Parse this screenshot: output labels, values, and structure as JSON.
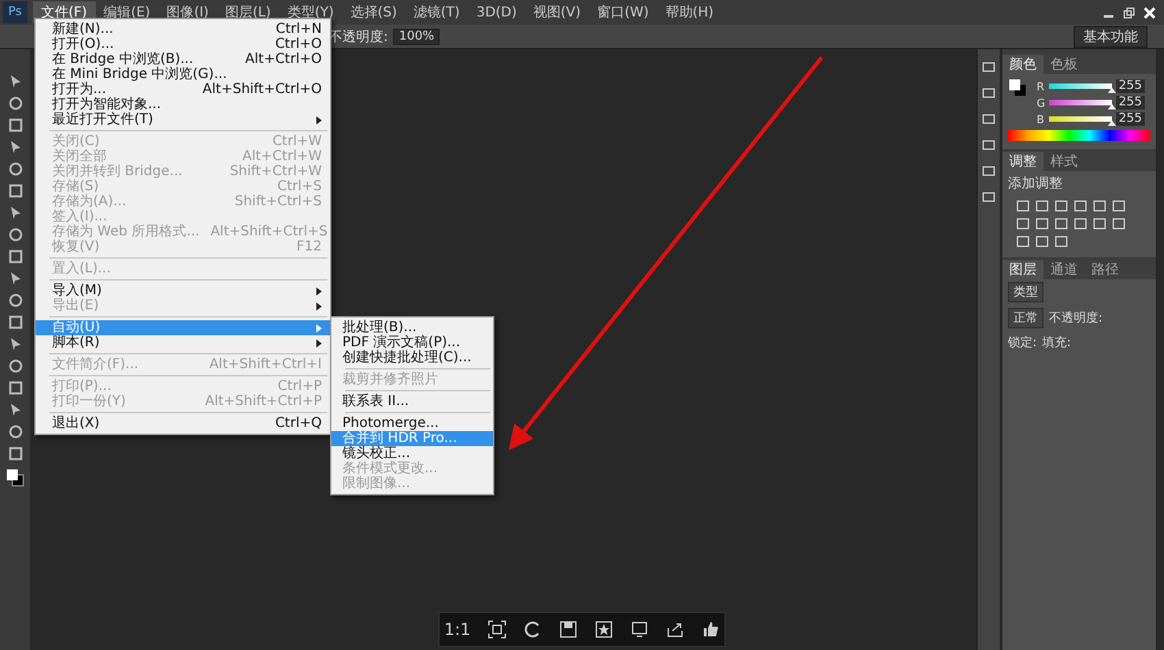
{
  "menu_bar": {
    "logo": "Ps",
    "items": [
      {
        "label": "文件(F)",
        "selected": true
      },
      {
        "label": "编辑(E)",
        "selected": false
      },
      {
        "label": "图像(I)",
        "selected": false
      },
      {
        "label": "图层(L)",
        "selected": false
      },
      {
        "label": "类型(Y)",
        "selected": false
      },
      {
        "label": "选择(S)",
        "selected": false
      },
      {
        "label": "滤镜(T)",
        "selected": false
      },
      {
        "label": "3D(D)",
        "selected": false
      },
      {
        "label": "视图(V)",
        "selected": false
      },
      {
        "label": "窗口(W)",
        "selected": false
      },
      {
        "label": "帮助(H)",
        "selected": false
      }
    ]
  },
  "options_bar": {
    "opacity_label": "不透明度:",
    "opacity_value": "100%",
    "workspace": "基本功能"
  },
  "file_menu": {
    "items": [
      {
        "kind": "item",
        "label": "新建(N)...",
        "shortcut": "Ctrl+N",
        "disabled": false,
        "selected": false,
        "submenu": false
      },
      {
        "kind": "item",
        "label": "打开(O)...",
        "shortcut": "Ctrl+O",
        "disabled": false,
        "selected": false,
        "submenu": false
      },
      {
        "kind": "item",
        "label": "在 Bridge 中浏览(B)...",
        "shortcut": "Alt+Ctrl+O",
        "disabled": false,
        "selected": false,
        "submenu": false
      },
      {
        "kind": "item",
        "label": "在 Mini Bridge 中浏览(G)...",
        "disabled": false,
        "selected": false,
        "submenu": false
      },
      {
        "kind": "item",
        "label": "打开为...",
        "shortcut": "Alt+Shift+Ctrl+O",
        "disabled": false,
        "selected": false,
        "submenu": false
      },
      {
        "kind": "item",
        "label": "打开为智能对象...",
        "disabled": false,
        "selected": false,
        "submenu": false
      },
      {
        "kind": "item",
        "label": "最近打开文件(T)",
        "disabled": false,
        "selected": false,
        "submenu": true
      },
      {
        "kind": "separator"
      },
      {
        "kind": "item",
        "label": "关闭(C)",
        "shortcut": "Ctrl+W",
        "disabled": true,
        "selected": false,
        "submenu": false
      },
      {
        "kind": "item",
        "label": "关闭全部",
        "shortcut": "Alt+Ctrl+W",
        "disabled": true,
        "selected": false,
        "submenu": false
      },
      {
        "kind": "item",
        "label": "关闭并转到 Bridge...",
        "shortcut": "Shift+Ctrl+W",
        "disabled": true,
        "selected": false,
        "submenu": false
      },
      {
        "kind": "item",
        "label": "存储(S)",
        "shortcut": "Ctrl+S",
        "disabled": true,
        "selected": false,
        "submenu": false
      },
      {
        "kind": "item",
        "label": "存储为(A)...",
        "shortcut": "Shift+Ctrl+S",
        "disabled": true,
        "selected": false,
        "submenu": false
      },
      {
        "kind": "item",
        "label": "签入(I)...",
        "disabled": true,
        "selected": false,
        "submenu": false
      },
      {
        "kind": "item",
        "label": "存储为 Web 所用格式...",
        "shortcut": "Alt+Shift+Ctrl+S",
        "disabled": true,
        "selected": false,
        "submenu": false
      },
      {
        "kind": "item",
        "label": "恢复(V)",
        "shortcut": "F12",
        "disabled": true,
        "selected": false,
        "submenu": false
      },
      {
        "kind": "separator"
      },
      {
        "kind": "item",
        "label": "置入(L)...",
        "disabled": true,
        "selected": false,
        "submenu": false
      },
      {
        "kind": "separator"
      },
      {
        "kind": "item",
        "label": "导入(M)",
        "disabled": false,
        "selected": false,
        "submenu": true
      },
      {
        "kind": "item",
        "label": "导出(E)",
        "disabled": true,
        "selected": false,
        "submenu": true
      },
      {
        "kind": "separator"
      },
      {
        "kind": "item",
        "label": "自动(U)",
        "disabled": false,
        "selected": true,
        "submenu": true,
        "children": [
          {
            "kind": "item",
            "label": "批处理(B)...",
            "disabled": false,
            "selected": false
          },
          {
            "kind": "item",
            "label": "PDF 演示文稿(P)...",
            "disabled": false,
            "selected": false
          },
          {
            "kind": "item",
            "label": "创建快捷批处理(C)...",
            "disabled": false,
            "selected": false
          },
          {
            "kind": "separator"
          },
          {
            "kind": "item",
            "label": "裁剪并修齐照片",
            "disabled": true,
            "selected": false
          },
          {
            "kind": "separator"
          },
          {
            "kind": "item",
            "label": "联系表 II...",
            "disabled": false,
            "selected": false
          },
          {
            "kind": "separator"
          },
          {
            "kind": "item",
            "label": "Photomerge...",
            "disabled": false,
            "selected": false
          },
          {
            "kind": "item",
            "label": "合并到 HDR Pro...",
            "disabled": false,
            "selected": true
          },
          {
            "kind": "item",
            "label": "镜头校正...",
            "disabled": false,
            "selected": false
          },
          {
            "kind": "item",
            "label": "条件模式更改...",
            "disabled": true,
            "selected": false
          },
          {
            "kind": "item",
            "label": "限制图像...",
            "disabled": true,
            "selected": false
          }
        ]
      },
      {
        "kind": "item",
        "label": "脚本(R)",
        "disabled": false,
        "selected": false,
        "submenu": true
      },
      {
        "kind": "separator"
      },
      {
        "kind": "item",
        "label": "文件简介(F)...",
        "shortcut": "Alt+Shift+Ctrl+I",
        "disabled": true,
        "selected": false,
        "submenu": false
      },
      {
        "kind": "separator"
      },
      {
        "kind": "item",
        "label": "打印(P)...",
        "shortcut": "Ctrl+P",
        "disabled": true,
        "selected": false,
        "submenu": false
      },
      {
        "kind": "item",
        "label": "打印一份(Y)",
        "shortcut": "Alt+Shift+Ctrl+P",
        "disabled": true,
        "selected": false,
        "submenu": false
      },
      {
        "kind": "separator"
      },
      {
        "kind": "item",
        "label": "退出(X)",
        "shortcut": "Ctrl+Q",
        "disabled": false,
        "selected": false,
        "submenu": false
      }
    ]
  },
  "color_panel": {
    "tabs": [
      {
        "label": "颜色",
        "selected": true
      },
      {
        "label": "色板",
        "selected": false
      }
    ],
    "channels": [
      {
        "name": "R",
        "level": 1,
        "reading": "255"
      },
      {
        "name": "G",
        "level": 1,
        "reading": "255"
      },
      {
        "name": "B",
        "level": 1,
        "reading": "255"
      }
    ]
  },
  "adjust_panel": {
    "tabs": [
      {
        "label": "调整",
        "selected": true
      },
      {
        "label": "样式",
        "selected": false
      }
    ],
    "title": "添加调整"
  },
  "layers_panel": {
    "tabs": [
      {
        "label": "图层",
        "selected": true
      },
      {
        "label": "通道",
        "selected": false
      },
      {
        "label": "路径",
        "selected": false
      }
    ],
    "filter": "类型",
    "blend": "正常",
    "opacity_label": "不透明度:",
    "lock_label": "锁定:",
    "fill_label": "填充:"
  },
  "viewer_toolbar": {
    "zoom_label": "1:1"
  }
}
